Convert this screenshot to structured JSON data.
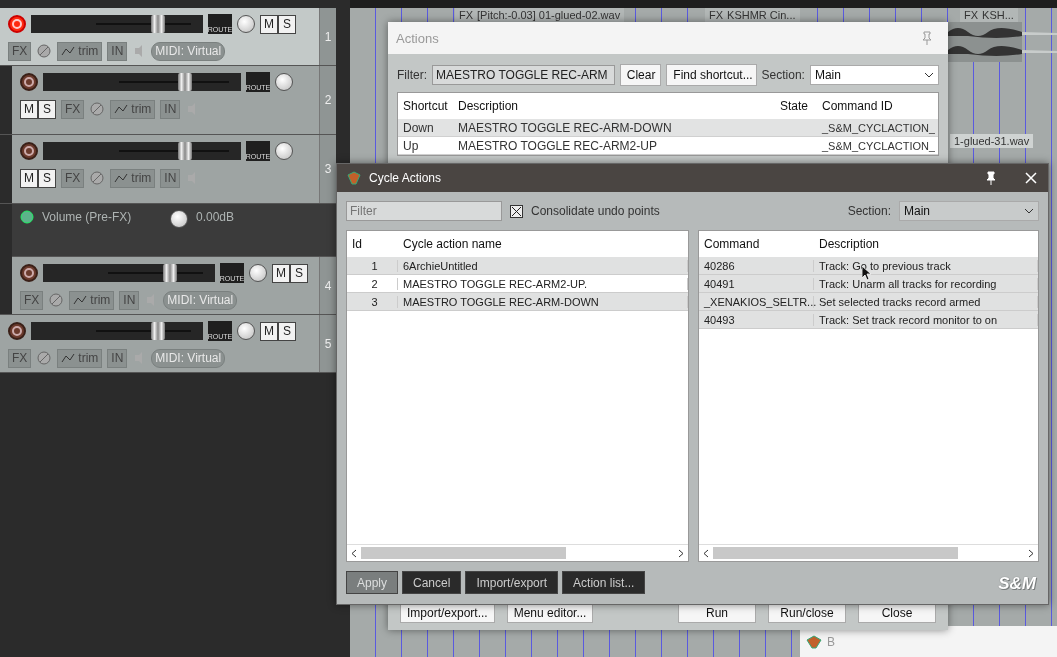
{
  "tracks": [
    {
      "number": "1",
      "selected": true,
      "armed": true,
      "kind": "midi",
      "level": 0.65,
      "mute": "M",
      "solo": "S",
      "fx": "FX",
      "trim": "trim",
      "input_button": "IN",
      "route": "ROUTE",
      "midi_input": "MIDI: Virtual",
      "children": [
        {
          "number": "2",
          "selected": false,
          "armed": false,
          "kind": "audio",
          "level": 0.6,
          "mute": "M",
          "solo": "S",
          "fx": "FX",
          "trim": "trim",
          "input_button": "IN",
          "route": "ROUTE"
        },
        {
          "number": "3",
          "selected": false,
          "armed": false,
          "kind": "audio",
          "level": 0.6,
          "mute": "M",
          "solo": "S",
          "fx": "FX",
          "trim": "trim",
          "input_button": "IN",
          "route": "ROUTE",
          "envelopes": [
            {
              "name": "Volume (Pre-FX)",
              "value": "0.00dB"
            }
          ]
        },
        {
          "number": "4",
          "selected": false,
          "armed": false,
          "kind": "midi",
          "level": 0.65,
          "mute": "M",
          "solo": "S",
          "fx": "FX",
          "trim": "trim",
          "input_button": "IN",
          "route": "ROUTE",
          "midi_input": "MIDI: Virtual"
        }
      ]
    },
    {
      "number": "5",
      "selected": false,
      "armed": false,
      "kind": "midi",
      "level": 0.65,
      "mute": "M",
      "solo": "S",
      "fx": "FX",
      "trim": "trim",
      "input_button": "IN",
      "route": "ROUTE",
      "midi_input": "MIDI: Virtual"
    }
  ],
  "timeline": {
    "items": [
      {
        "label": "[Pitch:-0.03] 01-glued-02.wav",
        "fx": "FX"
      },
      {
        "label": "KSHMR Cin...",
        "fx": "FX"
      },
      {
        "label": "KSH...",
        "fx": "FX"
      }
    ],
    "lower_item": "1-glued-31.wav"
  },
  "actions_window": {
    "title": "Actions",
    "filter_label": "Filter:",
    "filter_value": "MAESTRO TOGGLE REC-ARM",
    "clear": "Clear",
    "find_shortcut": "Find shortcut...",
    "section_label": "Section:",
    "section_value": "Main",
    "columns": [
      "Shortcut",
      "Description",
      "State",
      "Command ID"
    ],
    "rows": [
      {
        "shortcut": "Down",
        "description": "MAESTRO TOGGLE REC-ARM-DOWN",
        "command_id": "_S&M_CYCLACTION_",
        "selected": false
      },
      {
        "shortcut": "Up",
        "description": "MAESTRO TOGGLE REC-ARM2-UP",
        "command_id": "_S&M_CYCLACTION_",
        "selected": true
      }
    ],
    "buttons": [
      "Import/export...",
      "Menu editor...",
      "Run",
      "Run/close",
      "Close"
    ]
  },
  "cycle_window": {
    "title": "Cycle Actions",
    "filter_placeholder": "Filter",
    "consolidate_label": "Consolidate undo points",
    "consolidate_checked": true,
    "section_label": "Section:",
    "section_value": "Main",
    "left_columns": [
      "Id",
      "Cycle action name"
    ],
    "cycle_actions": [
      {
        "id": "1",
        "name": "6ArchieUntitled",
        "selected": false
      },
      {
        "id": "2",
        "name": "MAESTRO TOGGLE REC-ARM2-UP.",
        "selected": true
      },
      {
        "id": "3",
        "name": "MAESTRO TOGGLE REC-ARM-DOWN",
        "selected": false
      }
    ],
    "right_columns": [
      "Command",
      "Description"
    ],
    "commands": [
      {
        "command": "40286",
        "description": "Track: Go to previous track"
      },
      {
        "command": "40491",
        "description": "Track: Unarm all tracks for recording"
      },
      {
        "command": "_XENAKIOS_SELTR...",
        "description": "Set selected tracks record armed"
      },
      {
        "command": "40493",
        "description": "Track: Set track record monitor to on"
      }
    ],
    "buttons": [
      {
        "label": "Apply",
        "disabled": true
      },
      {
        "label": "Cancel",
        "disabled": false
      },
      {
        "label": "Import/export",
        "disabled": false
      },
      {
        "label": "Action list...",
        "disabled": false
      }
    ],
    "logo": "S&M"
  },
  "project_tab": {
    "label": "B"
  }
}
